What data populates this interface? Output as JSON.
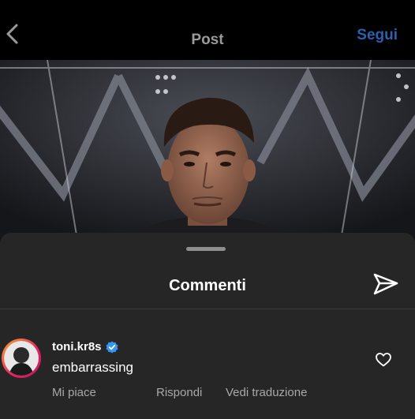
{
  "header": {
    "title": "Post",
    "follow_label": "Segui"
  },
  "comments_sheet": {
    "title": "Commenti"
  },
  "comments": [
    {
      "username": "toni.kr8s",
      "verified": true,
      "text": "embarrassing",
      "actions": {
        "like": "Mi piace",
        "reply": "Rispondi",
        "translate": "Vedi traduzione"
      }
    }
  ]
}
